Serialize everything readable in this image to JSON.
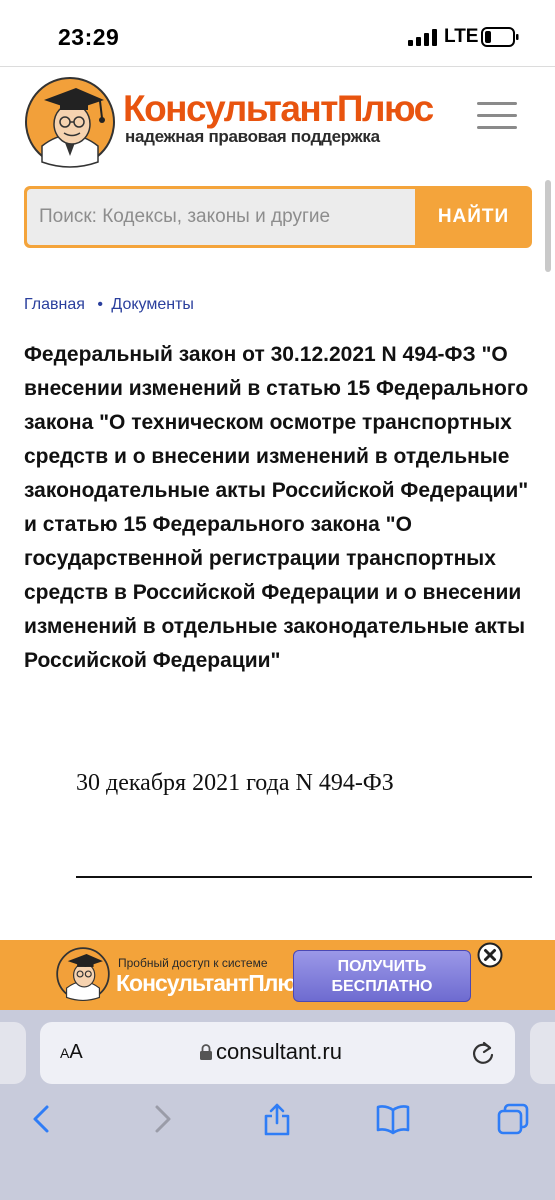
{
  "status_bar": {
    "time": "23:29",
    "network": "LTE"
  },
  "header": {
    "brand": "КонсультантПлюс",
    "tagline": "надежная правовая поддержка"
  },
  "search": {
    "placeholder": "Поиск: Кодексы, законы и другие",
    "button_label": "НАЙТИ"
  },
  "breadcrumb": {
    "items": [
      {
        "label": "Главная"
      },
      {
        "label": "Документы"
      }
    ],
    "separator": "•"
  },
  "document": {
    "title": "Федеральный закон от 30.12.2021 N 494-ФЗ \"О внесении изменений в статью 15 Федерального закона \"О техническом осмотре транспортных средств и о внесении изменений в отдельные законодательные акты Российской Федерации\" и статью 15 Федерального закона \"О государственной регистрации транспортных средств в Российской Федерации и о внесении изменений в отдельные законодательные акты Российской Федерации\"",
    "date_line": "30 декабря 2021 года N 494-ФЗ"
  },
  "promo": {
    "caption": "Пробный доступ к системе",
    "brand": "КонсультантПлюс",
    "cta_line1": "ПОЛУЧИТЬ",
    "cta_line2": "БЕСПЛАТНО"
  },
  "browser": {
    "aa_small": "A",
    "aa_large": "A",
    "url": "consultant.ru"
  },
  "icons": {
    "menu": "hamburger-icon",
    "close": "close-icon",
    "lock": "lock-icon",
    "reload": "reload-icon",
    "back": "chevron-left-icon",
    "forward": "chevron-right-icon",
    "share": "share-icon",
    "bookmarks": "book-icon",
    "tabs": "tabs-icon"
  },
  "colors": {
    "brand_orange": "#e8540f",
    "search_orange": "#f4a43b",
    "link_blue": "#2a3f9d",
    "toolbar_accent": "#2f7df6",
    "cta_purple": "#6e6bd0"
  }
}
